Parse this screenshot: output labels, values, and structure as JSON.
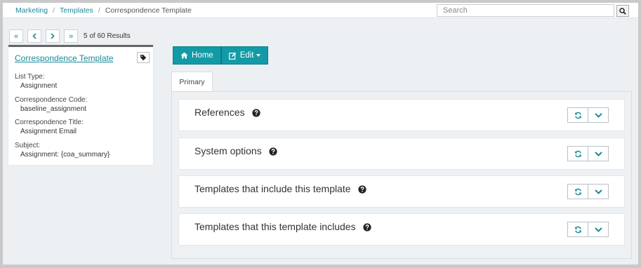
{
  "breadcrumb": {
    "items": [
      "Marketing",
      "Templates"
    ],
    "current": "Correspondence Template"
  },
  "search": {
    "placeholder": "Search"
  },
  "pager": {
    "first": "«",
    "prev": "‹",
    "next": "›",
    "last": "»",
    "count": "5 of 60 Results"
  },
  "record": {
    "title": "Correspondence Template",
    "fields": [
      {
        "label": "List Type:",
        "value": "Assignment"
      },
      {
        "label": "Correspondence Code:",
        "value": "baseline_assignment"
      },
      {
        "label": "Correspondence Title:",
        "value": "Assignment Email"
      },
      {
        "label": "Subject:",
        "value": "Assignment: {coa_summary}"
      }
    ]
  },
  "toolbar": {
    "home_label": "Home",
    "edit_label": "Edit"
  },
  "tabs": [
    {
      "label": "Primary"
    }
  ],
  "sections": [
    {
      "title": "References"
    },
    {
      "title": "System options"
    },
    {
      "title": "Templates that include this template"
    },
    {
      "title": "Templates that this template includes"
    }
  ],
  "icons": {
    "search": "search-icon",
    "tag": "tag-icon",
    "home": "home-icon",
    "edit": "edit-icon",
    "help": "question-circle-icon",
    "refresh": "refresh-icon",
    "expand": "chevron-down-icon"
  },
  "colors": {
    "accent": "#139aa7",
    "link": "#1b8a99",
    "background": "#edf0f3"
  }
}
